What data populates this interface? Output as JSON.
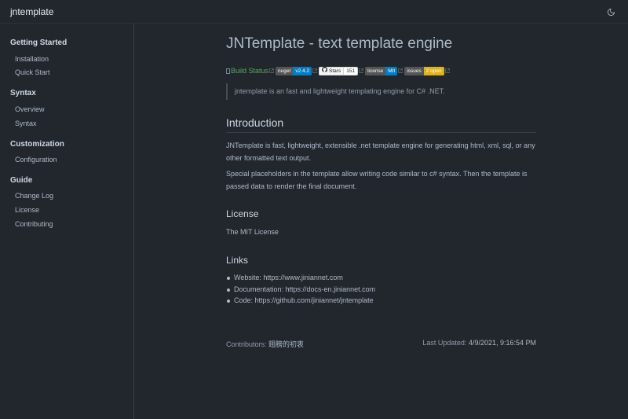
{
  "navbar": {
    "site_name": "jntemplate",
    "theme_toggle_icon": "moon-icon"
  },
  "sidebar": {
    "groups": [
      {
        "title": "Getting Started",
        "items": [
          "Installation",
          "Quick Start"
        ]
      },
      {
        "title": "Syntax",
        "items": [
          "Overview",
          "Syntax"
        ]
      },
      {
        "title": "Customization",
        "items": [
          "Configuration"
        ]
      },
      {
        "title": "Guide",
        "items": [
          "Change Log",
          "License",
          "Contributing"
        ]
      }
    ]
  },
  "page": {
    "title": "JNTemplate - text template engine",
    "badges": {
      "build_status_alt": "Build Status",
      "nuget_label": "nuget",
      "nuget_value": "v2.4.2",
      "stars_label": "Stars",
      "stars_value": "151",
      "license_label": "license",
      "license_value": "MIt",
      "issues_label": "issues",
      "issues_value": "2 open"
    },
    "quote": "jntemplate is an fast and lightweight templating engine for C# .NET.",
    "intro_heading": "Introduction",
    "intro_p1": "JNTemplate is fast, lightweight, extensible .net template engine for generating html, xml, sql, or any other formatted text output.",
    "intro_p2": "Special placeholders in the template allow writing code similar to c# syntax. Then the template is passed data to render the final document.",
    "license_heading": "License",
    "license_text": "The MIT License",
    "links_heading": "Links",
    "links": [
      "Website: https://www.jiniannet.com",
      "Documentation: https://docs-en.jiniannet.com",
      "Code: https://github.com/jiniannet/jntemplate"
    ]
  },
  "footer": {
    "contributors_label": "Contributors:",
    "contributors_value": "翅膀的初衷",
    "last_updated_label": "Last Updated:",
    "last_updated_value": "4/9/2021, 9:16:54 PM"
  },
  "colors": {
    "background": "#22272e",
    "nuget_badge": "#007ec6",
    "license_badge": "#007ec6",
    "issues_badge": "#dfb317",
    "link_green": "#57ab5a"
  }
}
